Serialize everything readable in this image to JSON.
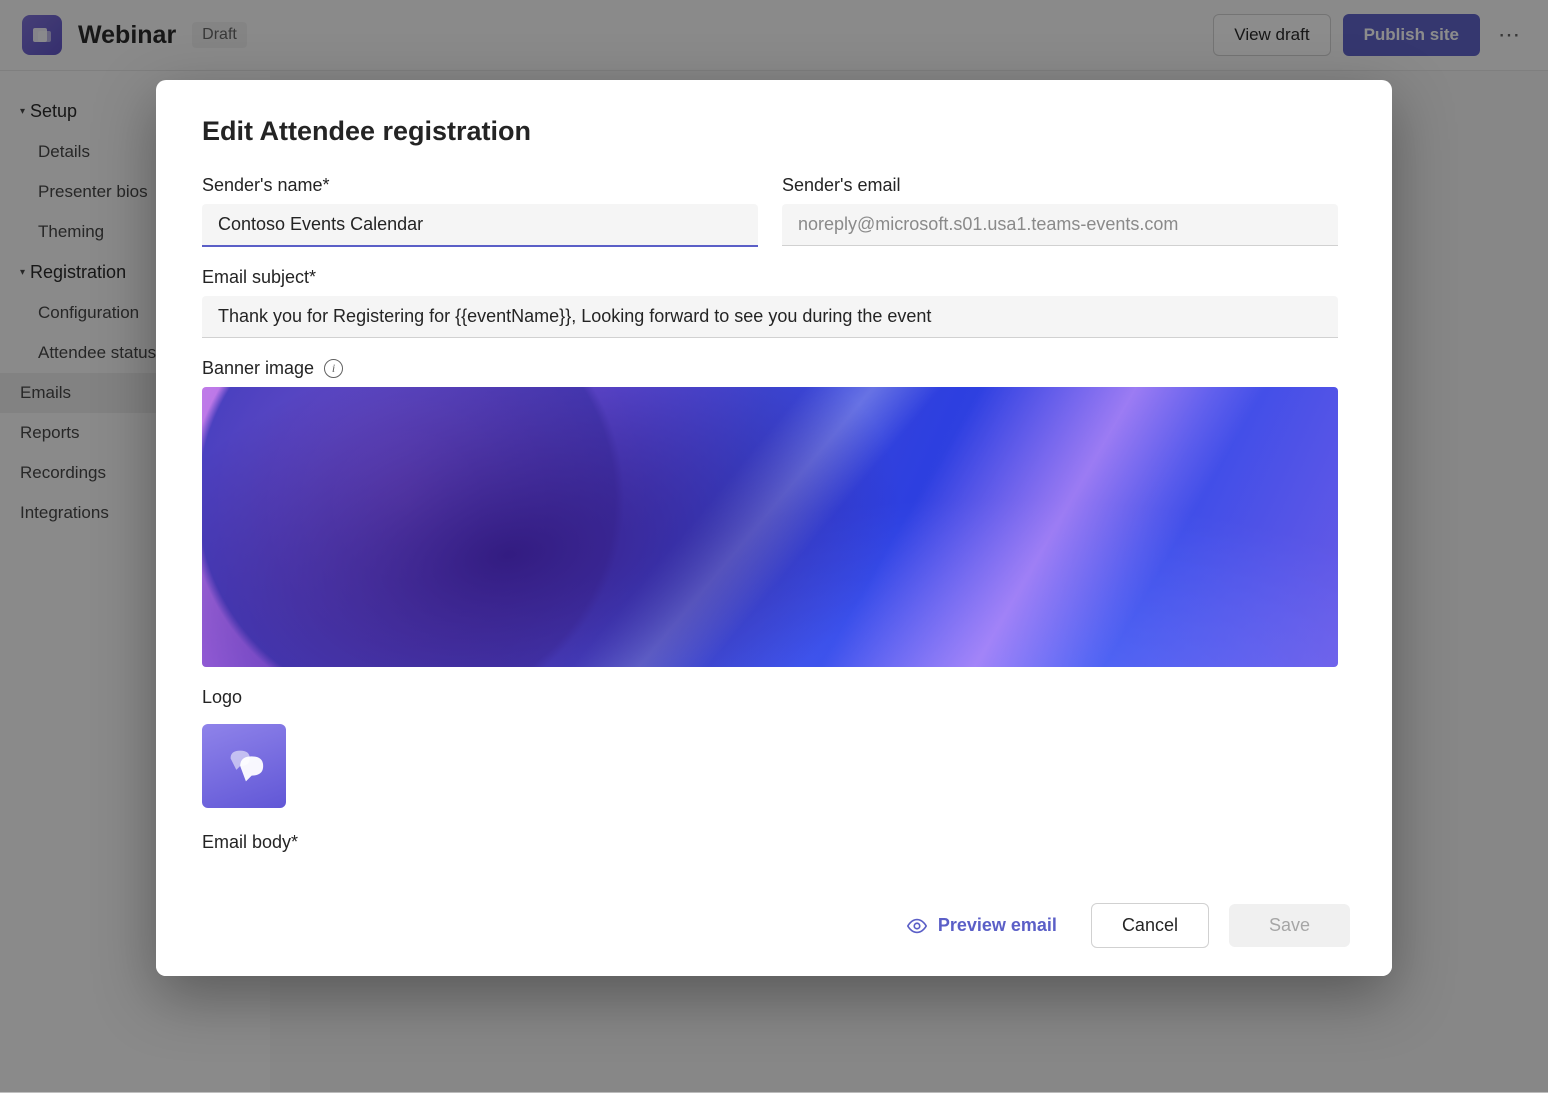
{
  "header": {
    "title": "Webinar",
    "status_badge": "Draft",
    "view_draft_label": "View draft",
    "publish_label": "Publish site"
  },
  "sidebar": {
    "setup_label": "Setup",
    "setup_items": [
      "Details",
      "Presenter bios",
      "Theming"
    ],
    "registration_label": "Registration",
    "registration_items": [
      "Configuration",
      "Attendee status"
    ],
    "other_items": [
      "Emails",
      "Reports",
      "Recordings",
      "Integrations"
    ]
  },
  "modal": {
    "title": "Edit Attendee registration",
    "sender_name_label": "Sender's name*",
    "sender_name_value": "Contoso Events Calendar",
    "sender_email_label": "Sender's email",
    "sender_email_value": "noreply@microsoft.s01.usa1.teams-events.com",
    "email_subject_label": "Email subject*",
    "email_subject_value": "Thank you for Registering for {{eventName}}, Looking forward to see you during the event",
    "banner_label": "Banner image",
    "logo_label": "Logo",
    "email_body_label": "Email body*",
    "footer": {
      "preview_label": "Preview email",
      "cancel_label": "Cancel",
      "save_label": "Save"
    }
  }
}
